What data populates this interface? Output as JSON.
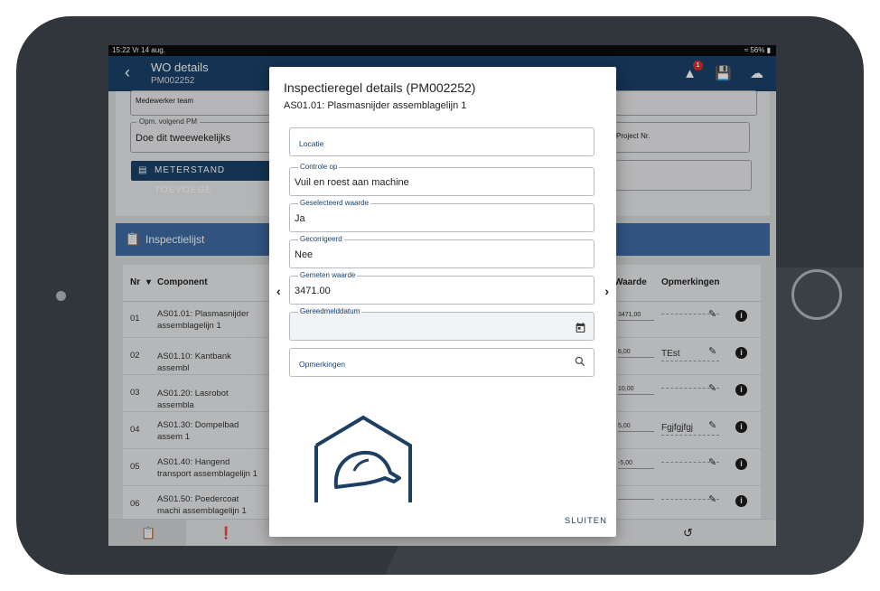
{
  "status_bar": {
    "time_date": "15:22  Vr 14 aug.",
    "battery": "56%"
  },
  "app_bar": {
    "title": "WO details",
    "subtitle": "PM002252",
    "alert_count": "1"
  },
  "form": {
    "medewerker_team_label": "Medewerker team",
    "opm_volgend_pm_label": "Opm. volgend PM",
    "opm_volgend_pm_value": "Doe dit tweewekelijks",
    "project_nr_label": "Project Nr.",
    "meterstand_button": "METERSTAND TOEVOEGE"
  },
  "inspectie": {
    "title": "Inspectielijst",
    "columns": {
      "nr": "Nr",
      "component": "Component",
      "waarde": "Waarde",
      "opmerkingen": "Opmerkingen"
    },
    "rows": [
      {
        "nr": "01",
        "component": "AS01.01: Plasmasnijder assemblagelijn 1",
        "waarde": "3471,00",
        "opmerking": ""
      },
      {
        "nr": "02",
        "component": "AS01.10: Kantbank assembl",
        "waarde": "6,00",
        "opmerking": "TEst"
      },
      {
        "nr": "03",
        "component": "AS01.20: Lasrobot assembla",
        "waarde": "10,00",
        "opmerking": ""
      },
      {
        "nr": "04",
        "component": "AS01.30: Dompelbad assem 1",
        "waarde": "5,00",
        "opmerking": "Fgjfgjfgj"
      },
      {
        "nr": "05",
        "component": "AS01.40: Hangend transport assemblagelijn 1",
        "waarde": "-5,00",
        "opmerking": ""
      },
      {
        "nr": "06",
        "component": "AS01.50: Poedercoat machi assemblagelijn 1",
        "waarde": "",
        "opmerking": ""
      }
    ]
  },
  "dialog": {
    "title": "Inspectieregel details (PM002252)",
    "subtitle": "AS01.01: Plasmasnijder assemblagelijn 1",
    "locatie_label": "Locatie",
    "controle_label": "Controle op",
    "controle_value": "Vuil en roest aan machine",
    "geselecteerd_label": "Geselecteerd waarde",
    "geselecteerd_value": "Ja",
    "gecorrigeerd_label": "Gecorrigeerd",
    "gecorrigeerd_value": "Nee",
    "gemeten_label": "Gemeten waarde",
    "gemeten_value": "3471.00",
    "gereed_label": "Gereedmelddatum",
    "opmerkingen_label": "Opmerkingen",
    "close_label": "SLUITEN"
  },
  "colors": {
    "primary": "#1a416a",
    "header": "#3f6ba3",
    "bezel": "#30363c"
  },
  "icons": [
    "back-icon",
    "alert-icon",
    "save-icon",
    "cloud-upload-icon",
    "calendar-icon",
    "search-icon",
    "pencil-icon",
    "info-icon",
    "clipboard-icon",
    "history-icon"
  ]
}
